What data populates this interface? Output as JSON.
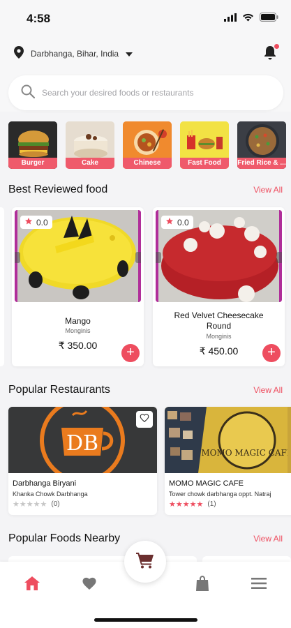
{
  "status": {
    "time": "4:58"
  },
  "header": {
    "location": "Darbhanga, Bihar, India"
  },
  "search": {
    "placeholder": "Search your desired foods or restaurants"
  },
  "categories": [
    {
      "label": "Burger"
    },
    {
      "label": "Cake"
    },
    {
      "label": "Chinese"
    },
    {
      "label": "Fast Food"
    },
    {
      "label": "Fried Rice & ..."
    }
  ],
  "best_reviewed": {
    "title": "Best Reviewed food",
    "view_all": "View All",
    "items": [
      {
        "rating": "0.0",
        "name": "Mango",
        "restaurant": "Monginis",
        "price": "₹ 350.00"
      },
      {
        "rating": "0.0",
        "name": "Red Velvet Cheesecake Round",
        "restaurant": "Monginis",
        "price": "₹ 450.00"
      }
    ]
  },
  "popular_restaurants": {
    "title": "Popular Restaurants",
    "view_all": "View All",
    "items": [
      {
        "logo_text": "DB",
        "name": "Darbhanga Biryani",
        "address": "Khanka Chowk Darbhanga",
        "rating_count": "(0)",
        "stars": 0
      },
      {
        "logo_text": "MOMO MAGIC CAFE",
        "name": "MOMO MAGIC CAFE",
        "address": "Tower chowk darbhanga oppt. Natraj",
        "rating_count": "(1)",
        "stars": 5
      }
    ]
  },
  "popular_foods_nearby": {
    "title": "Popular Foods Nearby",
    "view_all": "View All"
  },
  "colors": {
    "accent": "#ee4d5f",
    "star_inactive": "#c6c6c6"
  },
  "nav": {
    "icons": [
      "home-icon",
      "heart-icon",
      "cart-icon",
      "bag-icon",
      "menu-icon"
    ]
  }
}
